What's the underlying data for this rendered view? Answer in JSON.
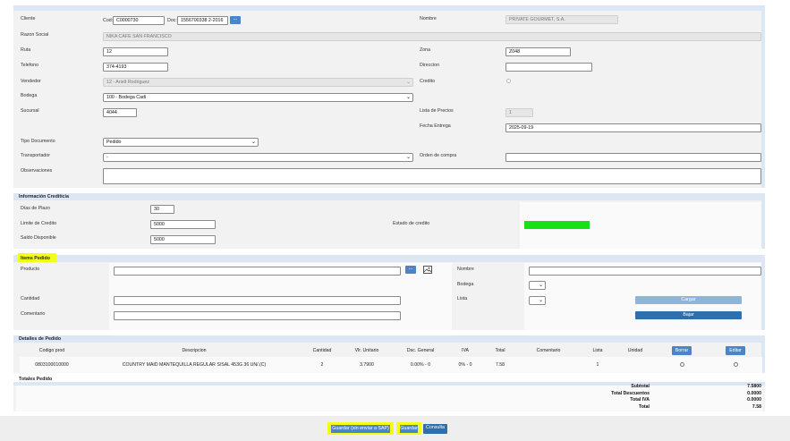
{
  "cliente": {
    "label": "Cliente",
    "cod_label": "Cod:",
    "cod_value": "C0000730",
    "doc_label": "Doc:",
    "doc_value": "1556700338 2-2016",
    "lookup_label": "...",
    "nombre_label": "Nombre",
    "nombre_value": "PRIVATE GOURMET, S.A."
  },
  "razon_social": {
    "label": "Razon Social",
    "value": "NIKA CAFE SAN FRANCISCO"
  },
  "ruta": {
    "label": "Ruta",
    "value": "12"
  },
  "zona": {
    "label": "Zona",
    "value": "Z048"
  },
  "telefono": {
    "label": "Telefono",
    "value": "374-4193"
  },
  "direccion": {
    "label": "Direccion",
    "value": ""
  },
  "vendedor": {
    "label": "Vendedor",
    "value": "12 - Arielt  Rodriguez"
  },
  "credito": {
    "label": "Credito"
  },
  "bodega": {
    "label": "Bodega",
    "value": "100 - Bodega Cadi"
  },
  "sucursal": {
    "label": "Sucursal",
    "value": "4044"
  },
  "lista_precios": {
    "label": "Lista de Precios",
    "value": "1"
  },
  "fecha_entrega": {
    "label": "Fecha Entrega",
    "value": "2025-09-19"
  },
  "tipo_documento": {
    "label": "Tipo Documento",
    "value": "Pedido"
  },
  "transportador": {
    "label": "Transportador",
    "value": "-"
  },
  "orden_compra": {
    "label": "Orden de compra",
    "value": ""
  },
  "observaciones": {
    "label": "Observaciones",
    "value": ""
  },
  "info_crediticia": {
    "title": "Información Crediticia",
    "dias_plazo_label": "Días de Plazo",
    "dias_plazo_value": "30",
    "limite_label": "Limite de Credito",
    "limite_value": "5000",
    "saldo_label": "Saldo Disponible",
    "saldo_value": "5000",
    "estado_label": "Estado de credito",
    "estado_color": "#16e016"
  },
  "items_pedido": {
    "title": "Items Pedido",
    "producto_label": "Producto",
    "producto_value": "",
    "lookup_label": "...",
    "nombre_label": "Nombre",
    "nombre_value": "",
    "bodega_label": "Bodega",
    "cantidad_label": "Cantidad",
    "lista_label": "Lista",
    "comentario_label": "Comentario",
    "cargar_label": "Cargar",
    "bajar_label": "Bajar"
  },
  "detalles": {
    "title": "Detalles de Pedido",
    "columns": [
      "Codigo prod",
      "Descripcion",
      "Cantidad",
      "Vlr. Unitario",
      "Dsc. General",
      "IVA",
      "Total",
      "Comentario",
      "Lista",
      "Unidad"
    ],
    "borrar_label": "Borrar",
    "editar_label": "Editar",
    "rows": [
      {
        "codigo": "0803100010000",
        "descripcion": "COUNTRY MAID MANTEQUILLA REGULAR S/SAL 453G 36 UN/.(C)",
        "cantidad": "2",
        "unitario": "3.7900",
        "descuento": "0.00% - 0",
        "iva": "0% - 0",
        "total": "7.58",
        "comentario": "",
        "lista": "1",
        "unidad": ""
      }
    ]
  },
  "totales": {
    "title": "Totales Pedido",
    "subtotal_label": "Subtotal",
    "subtotal_value": "7.5800",
    "descuentos_label": "Total Descuentos",
    "descuentos_value": "0.0000",
    "iva_label": "Total IVA",
    "iva_value": "0.0000",
    "total_label": "Total",
    "total_value": "7.58"
  },
  "footer": {
    "guardar_sin_sap_label": "Guardar (sin enviar a SAP)",
    "guardar_label": "Guardar",
    "consulta_label": "Consulta"
  },
  "colors": {
    "accent": "#4a86c7",
    "highlight": "#f4ff18",
    "header_band": "#dde7f3",
    "panel_bg": "#f2f2f2"
  }
}
